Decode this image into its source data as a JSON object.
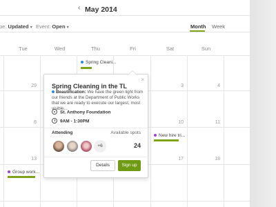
{
  "header": {
    "prev_icon": "chevron-left-icon",
    "next_icon": "chevron-right-icon",
    "month": "May 2014"
  },
  "filters": {
    "type": {
      "label": "pe:",
      "value": "Updated"
    },
    "event": {
      "label": "Event:",
      "value": "Open"
    }
  },
  "views": {
    "month": "Month",
    "week": "Week",
    "active": "Month"
  },
  "weekdays": [
    "",
    "Tue",
    "Wed",
    "Thu",
    "Fri",
    "Sat",
    "Sun"
  ],
  "days": {
    "r1": [
      "",
      "29",
      "",
      "",
      "",
      "3",
      "4"
    ],
    "r2": [
      "",
      "6",
      "",
      "",
      "",
      "10",
      "11"
    ],
    "r3": [
      "",
      "13",
      "",
      "",
      "",
      "17",
      "18"
    ]
  },
  "events": [
    {
      "label": "Spring Cleani...",
      "color": "#2b8bd6"
    },
    {
      "label": "New hire tri...",
      "color": "#a23fd1"
    },
    {
      "label": "Group work...",
      "color": "#a23fd1"
    }
  ],
  "popover": {
    "title": "Spring Cleaning in the TL",
    "category": "Beautification:",
    "description": "We have the green light from our friends at the Department of Public Works that we are ready to execute our largest, most visible...",
    "organization": "St. Anthony Foundation",
    "time": "9AM - 1:30PM",
    "attending_label": "Attending",
    "spots_label": "Available spots",
    "more_count": "+6",
    "spots_value": "24",
    "details_label": "Details",
    "signup_label": "Sign up",
    "close_icon": "close-icon"
  },
  "colors": {
    "accent": "#7ea21a",
    "signup": "#6f9a14",
    "event_blue": "#2b8bd6",
    "event_purple": "#a23fd1"
  }
}
